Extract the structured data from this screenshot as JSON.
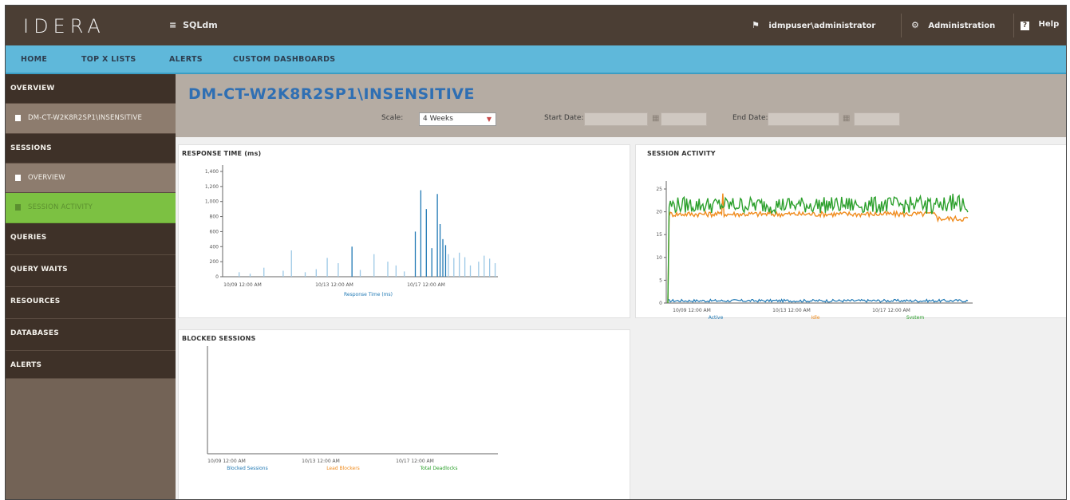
{
  "header": {
    "logo": "IDERA",
    "app_name": "SQLdm",
    "user": "idmpuser\\administrator",
    "administration_label": "Administration",
    "help_label": "Help"
  },
  "nav": {
    "items": [
      "HOME",
      "TOP X LISTS",
      "ALERTS",
      "CUSTOM DASHBOARDS"
    ]
  },
  "sidebar": {
    "overview": "OVERVIEW",
    "instance": "DM-CT-W2K8R2SP1\\INSENSITIVE",
    "sessions": "SESSIONS",
    "session_overview": "OVERVIEW",
    "session_activity": "SESSION ACTIVITY",
    "queries": "QUERIES",
    "query_waits": "QUERY WAITS",
    "resources": "RESOURCES",
    "databases": "DATABASES",
    "alerts": "ALERTS"
  },
  "main": {
    "title": "DM-CT-W2K8R2SP1\\INSENSITIVE",
    "scale_label": "Scale:",
    "scale_value": "4 Weeks",
    "start_date_label": "Start Date:",
    "end_date_label": "End Date:"
  },
  "colors": {
    "topbar": "#4b3e34",
    "navbar": "#5fb8da",
    "sidebar": "#736356",
    "active": "#7cc142",
    "title": "#2f6fb3",
    "series_blue": "#1f78b4",
    "series_orange": "#f08c1e",
    "series_green": "#2ca02c"
  },
  "panels": {
    "response_time_title": "RESPONSE TIME (ms)",
    "session_activity_title": "SESSION ACTIVITY",
    "blocked_sessions_title": "BLOCKED SESSIONS"
  },
  "chart_data": [
    {
      "type": "bar",
      "title": "RESPONSE TIME (ms)",
      "y_ticks": [
        "1,400",
        "1,200",
        "1,000",
        "800",
        "600",
        "400",
        "200",
        "0"
      ],
      "x_ticks": [
        "10/09 12:00 AM",
        "10/13 12:00 AM",
        "10/17 12:00 AM"
      ],
      "legend": [
        "Response Time (ms)"
      ],
      "ylim": [
        0,
        1400
      ],
      "x": [
        0.06,
        0.1,
        0.15,
        0.22,
        0.25,
        0.3,
        0.34,
        0.38,
        0.42,
        0.47,
        0.5,
        0.55,
        0.6,
        0.63,
        0.66,
        0.7,
        0.72,
        0.74,
        0.76,
        0.78,
        0.79,
        0.8,
        0.81,
        0.82,
        0.84,
        0.86,
        0.88,
        0.9,
        0.93,
        0.95,
        0.97,
        0.99
      ],
      "values": [
        60,
        40,
        120,
        80,
        350,
        60,
        100,
        250,
        180,
        400,
        90,
        300,
        200,
        150,
        70,
        600,
        1150,
        900,
        380,
        1100,
        700,
        500,
        420,
        300,
        250,
        320,
        260,
        150,
        200,
        280,
        240,
        180
      ]
    },
    {
      "type": "line",
      "title": "SESSION ACTIVITY",
      "y_ticks": [
        "25",
        "20",
        "15",
        "10",
        "5",
        "0"
      ],
      "x_ticks": [
        "10/09 12:00 AM",
        "10/13 12:00 AM",
        "10/17 12:00 AM"
      ],
      "legend": [
        "Active",
        "Idle",
        "System"
      ],
      "ylim": [
        0,
        25
      ],
      "series": [
        {
          "name": "Active",
          "level": 0.5,
          "noise": 0.3
        },
        {
          "name": "Idle",
          "level": 19.5,
          "noise": 0.6,
          "spike": 24
        },
        {
          "name": "System",
          "level": 21.5,
          "noise": 1.8
        }
      ]
    },
    {
      "type": "line",
      "title": "BLOCKED SESSIONS",
      "x_ticks": [
        "10/09 12:00 AM",
        "10/13 12:00 AM",
        "10/17 12:00 AM"
      ],
      "legend": [
        "Blocked Sessions",
        "Lead Blockers",
        "Total Deadlocks"
      ],
      "series": []
    }
  ]
}
